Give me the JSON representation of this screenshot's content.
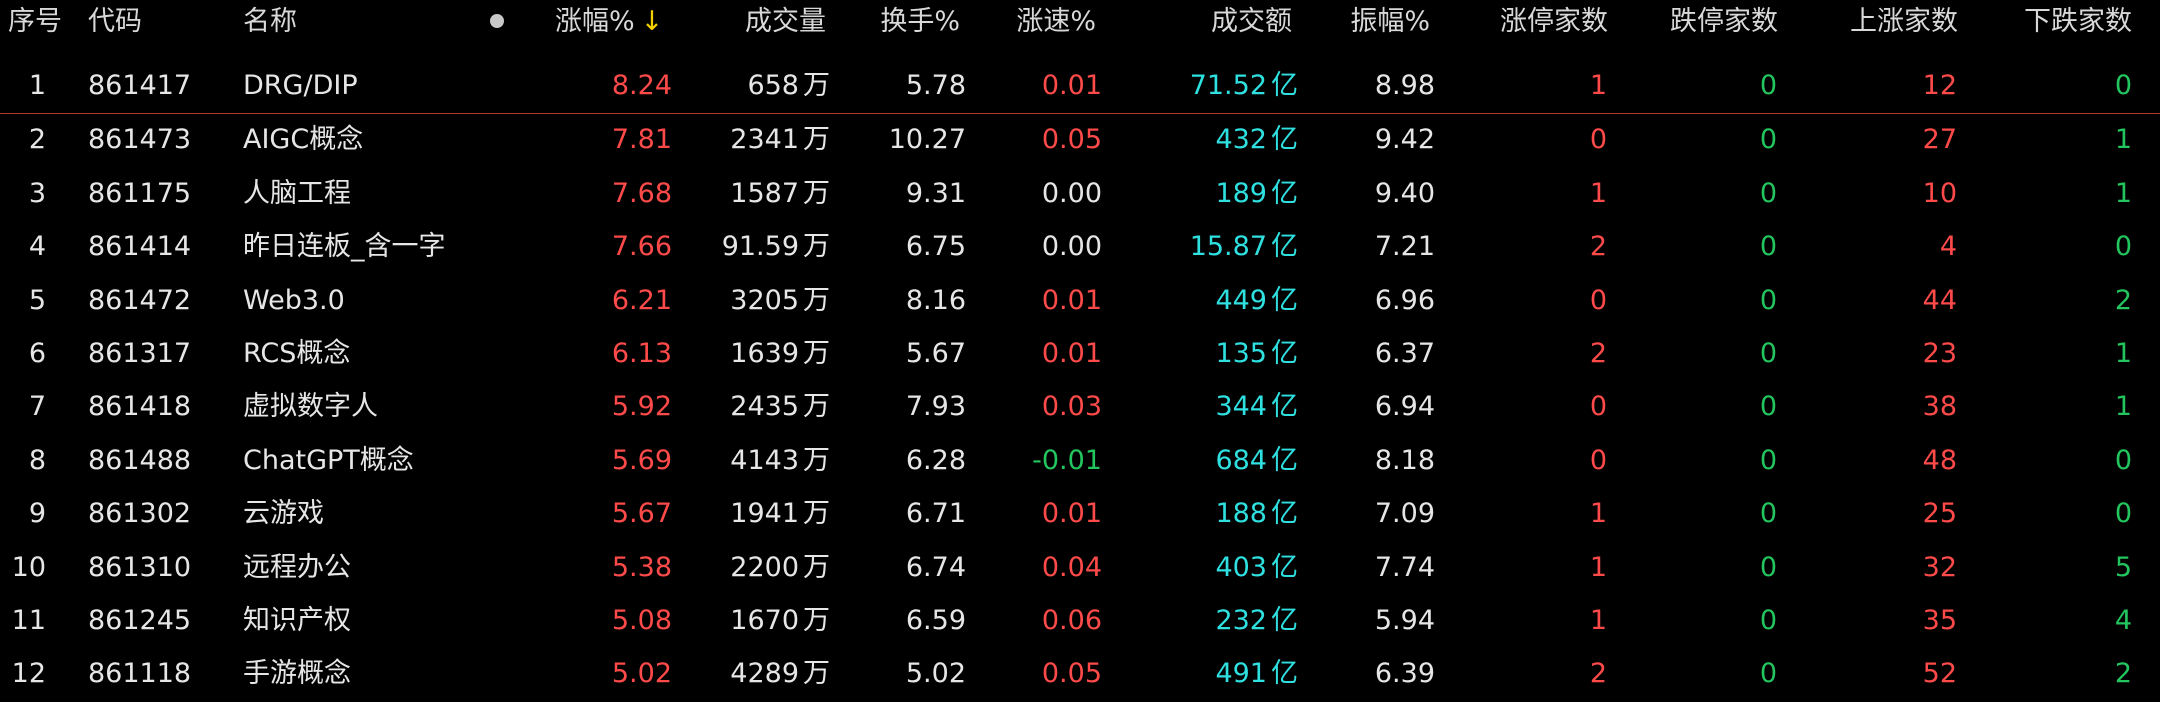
{
  "header": {
    "cols": [
      "序号",
      "代码",
      "名称",
      "涨幅%",
      "成交量",
      "换手%",
      "涨速%",
      "成交额",
      "振幅%",
      "涨停家数",
      "跌停家数",
      "上涨家数",
      "下跌家数"
    ],
    "sort_arrow": "↓"
  },
  "colors": {
    "up": "#ff4a4a",
    "down": "#22c55e",
    "amount": "#2fe0e0",
    "neutral": "#e6e6e6",
    "sort_arrow": "#f5d000"
  },
  "rows": [
    {
      "idx": "1",
      "code": "861417",
      "name": "DRG/DIP",
      "pct": "8.24",
      "vol": "658",
      "vol_unit": "万",
      "turnover": "5.78",
      "speed": "0.01",
      "amount": "71.52",
      "amount_unit": "亿",
      "amp": "8.98",
      "limit_up": "1",
      "limit_down": "0",
      "up": "12",
      "down": "0"
    },
    {
      "idx": "2",
      "code": "861473",
      "name": "AIGC概念",
      "pct": "7.81",
      "vol": "2341",
      "vol_unit": "万",
      "turnover": "10.27",
      "speed": "0.05",
      "amount": "432",
      "amount_unit": "亿",
      "amp": "9.42",
      "limit_up": "0",
      "limit_down": "0",
      "up": "27",
      "down": "1"
    },
    {
      "idx": "3",
      "code": "861175",
      "name": "人脑工程",
      "pct": "7.68",
      "vol": "1587",
      "vol_unit": "万",
      "turnover": "9.31",
      "speed": "0.00",
      "amount": "189",
      "amount_unit": "亿",
      "amp": "9.40",
      "limit_up": "1",
      "limit_down": "0",
      "up": "10",
      "down": "1"
    },
    {
      "idx": "4",
      "code": "861414",
      "name": "昨日连板_含一字",
      "pct": "7.66",
      "vol": "91.59",
      "vol_unit": "万",
      "turnover": "6.75",
      "speed": "0.00",
      "amount": "15.87",
      "amount_unit": "亿",
      "amp": "7.21",
      "limit_up": "2",
      "limit_down": "0",
      "up": "4",
      "down": "0"
    },
    {
      "idx": "5",
      "code": "861472",
      "name": "Web3.0",
      "pct": "6.21",
      "vol": "3205",
      "vol_unit": "万",
      "turnover": "8.16",
      "speed": "0.01",
      "amount": "449",
      "amount_unit": "亿",
      "amp": "6.96",
      "limit_up": "0",
      "limit_down": "0",
      "up": "44",
      "down": "2"
    },
    {
      "idx": "6",
      "code": "861317",
      "name": "RCS概念",
      "pct": "6.13",
      "vol": "1639",
      "vol_unit": "万",
      "turnover": "5.67",
      "speed": "0.01",
      "amount": "135",
      "amount_unit": "亿",
      "amp": "6.37",
      "limit_up": "2",
      "limit_down": "0",
      "up": "23",
      "down": "1"
    },
    {
      "idx": "7",
      "code": "861418",
      "name": "虚拟数字人",
      "pct": "5.92",
      "vol": "2435",
      "vol_unit": "万",
      "turnover": "7.93",
      "speed": "0.03",
      "amount": "344",
      "amount_unit": "亿",
      "amp": "6.94",
      "limit_up": "0",
      "limit_down": "0",
      "up": "38",
      "down": "1"
    },
    {
      "idx": "8",
      "code": "861488",
      "name": "ChatGPT概念",
      "pct": "5.69",
      "vol": "4143",
      "vol_unit": "万",
      "turnover": "6.28",
      "speed": "-0.01",
      "amount": "684",
      "amount_unit": "亿",
      "amp": "8.18",
      "limit_up": "0",
      "limit_down": "0",
      "up": "48",
      "down": "0"
    },
    {
      "idx": "9",
      "code": "861302",
      "name": "云游戏",
      "pct": "5.67",
      "vol": "1941",
      "vol_unit": "万",
      "turnover": "6.71",
      "speed": "0.01",
      "amount": "188",
      "amount_unit": "亿",
      "amp": "7.09",
      "limit_up": "1",
      "limit_down": "0",
      "up": "25",
      "down": "0"
    },
    {
      "idx": "10",
      "code": "861310",
      "name": "远程办公",
      "pct": "5.38",
      "vol": "2200",
      "vol_unit": "万",
      "turnover": "6.74",
      "speed": "0.04",
      "amount": "403",
      "amount_unit": "亿",
      "amp": "7.74",
      "limit_up": "1",
      "limit_down": "0",
      "up": "32",
      "down": "5"
    },
    {
      "idx": "11",
      "code": "861245",
      "name": "知识产权",
      "pct": "5.08",
      "vol": "1670",
      "vol_unit": "万",
      "turnover": "6.59",
      "speed": "0.06",
      "amount": "232",
      "amount_unit": "亿",
      "amp": "5.94",
      "limit_up": "1",
      "limit_down": "0",
      "up": "35",
      "down": "4"
    },
    {
      "idx": "12",
      "code": "861118",
      "name": "手游概念",
      "pct": "5.02",
      "vol": "4289",
      "vol_unit": "万",
      "turnover": "5.02",
      "speed": "0.05",
      "amount": "491",
      "amount_unit": "亿",
      "amp": "6.39",
      "limit_up": "2",
      "limit_down": "0",
      "up": "52",
      "down": "2"
    }
  ]
}
